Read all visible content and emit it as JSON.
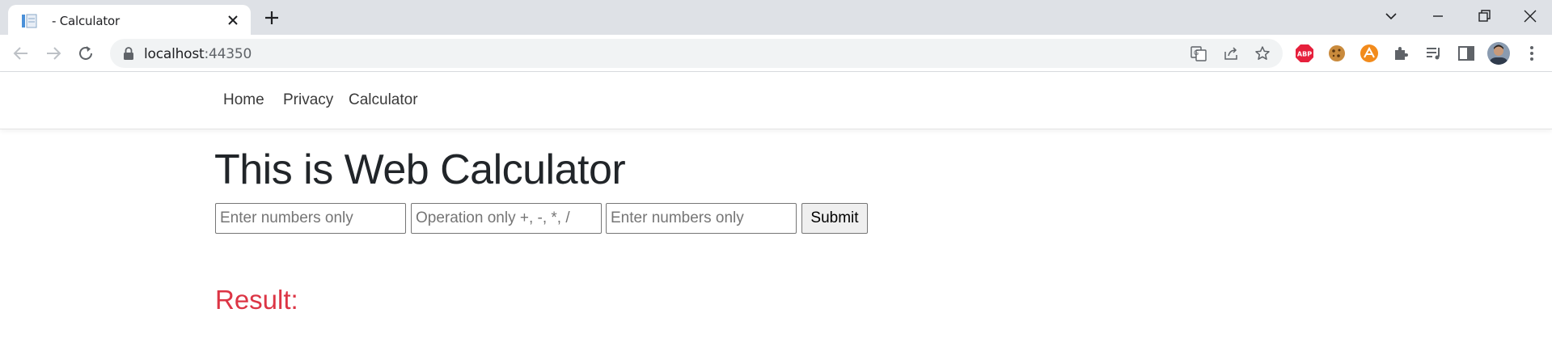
{
  "browser": {
    "tab_title": "- Calculator",
    "url_host": "localhost",
    "url_port": ":44350",
    "icons": [
      "calendar-favicon-icon",
      "close-icon",
      "plus-icon",
      "chevron-down-icon",
      "minimize-icon",
      "restore-icon",
      "close-window-icon",
      "back-icon",
      "forward-icon",
      "reload-icon",
      "lock-icon",
      "translate-icon",
      "share-icon",
      "star-icon",
      "adblock-icon",
      "cookie-icon",
      "extension-orange-icon",
      "puzzle-icon",
      "media-queue-icon",
      "side-panel-icon",
      "avatar",
      "kebab-menu-icon"
    ],
    "colors": {
      "tabstrip": "#dee1e6",
      "omnibox": "#f1f3f4",
      "adblock_red": "#e6203c",
      "orange_ext": "#f28b1c"
    }
  },
  "nav": {
    "items": [
      {
        "label": "Home"
      },
      {
        "label": "Privacy"
      },
      {
        "label": "Calculator"
      }
    ]
  },
  "main": {
    "title": "This is Web Calculator",
    "inputs": {
      "first_placeholder": "Enter numbers only",
      "operation_placeholder": "Operation only +, -, *, /",
      "second_placeholder": "Enter numbers only"
    },
    "submit_label": "Submit",
    "result_label": "Result:",
    "colors": {
      "result": "#dc3545",
      "title": "#212529"
    }
  }
}
